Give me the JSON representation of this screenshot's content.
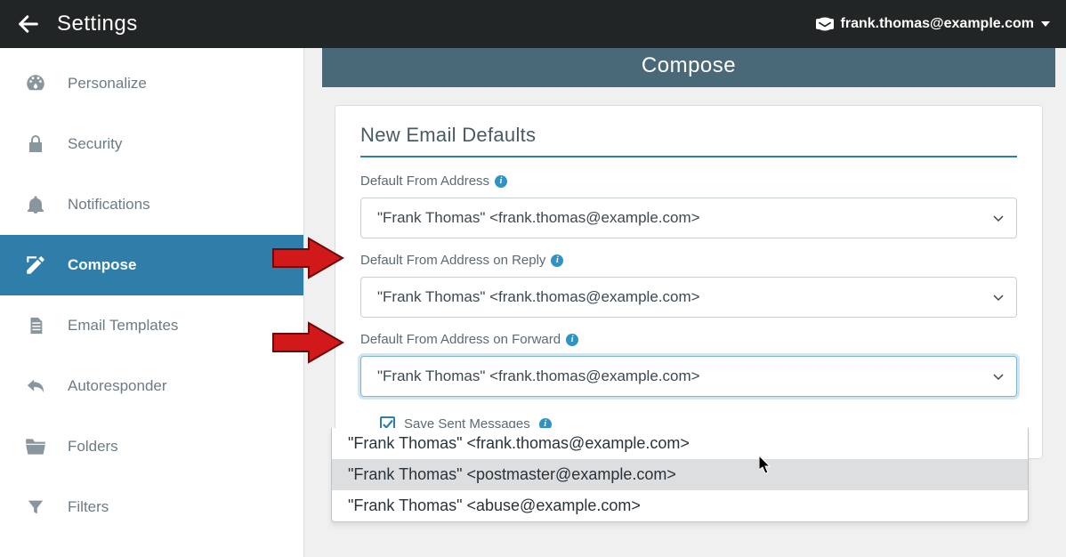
{
  "header": {
    "title": "Settings",
    "account": "frank.thomas@example.com"
  },
  "sidebar": {
    "items": [
      {
        "label": "Personalize"
      },
      {
        "label": "Security"
      },
      {
        "label": "Notifications"
      },
      {
        "label": "Compose"
      },
      {
        "label": "Email Templates"
      },
      {
        "label": "Autoresponder"
      },
      {
        "label": "Folders"
      },
      {
        "label": "Filters"
      }
    ]
  },
  "main": {
    "section_title": "Compose",
    "card_title": "New Email Defaults",
    "fields": {
      "from": {
        "label": "Default From Address",
        "value": "\"Frank Thomas\" <frank.thomas@example.com>"
      },
      "reply": {
        "label": "Default From Address on Reply",
        "value": "\"Frank Thomas\" <frank.thomas@example.com>"
      },
      "forward": {
        "label": "Default From Address on Forward",
        "value": "\"Frank Thomas\" <frank.thomas@example.com>",
        "options": [
          "\"Frank Thomas\" <frank.thomas@example.com>",
          "\"Frank Thomas\" <postmaster@example.com>",
          "\"Frank Thomas\" <abuse@example.com>"
        ]
      },
      "save_sent": {
        "label": "Save Sent Messages",
        "checked": true
      }
    }
  }
}
